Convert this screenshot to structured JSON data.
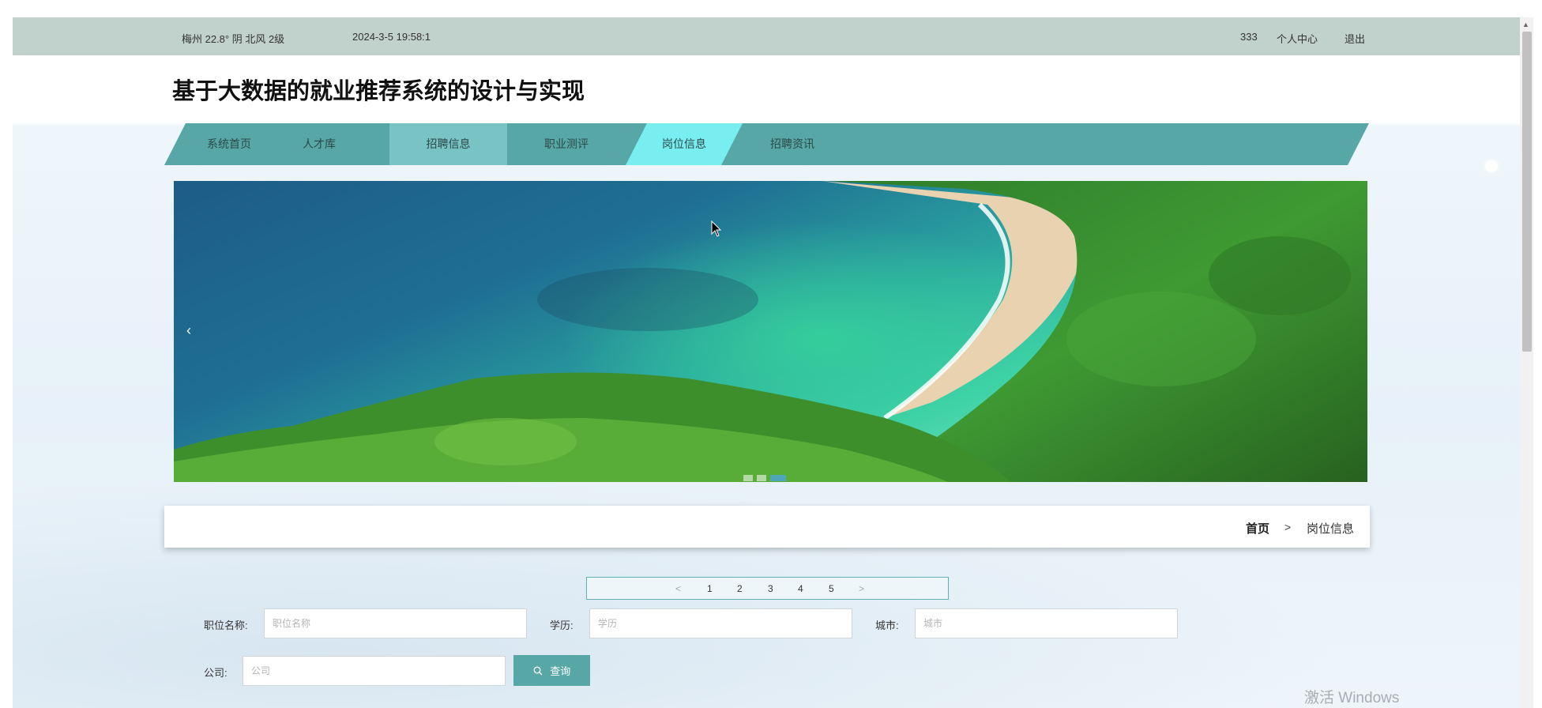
{
  "topbar": {
    "weather": "梅州 22.8° 阴 北风 2级",
    "datetime": "2024-3-5 19:58:1",
    "user": "333",
    "center": "个人中心",
    "logout": "退出"
  },
  "title": "基于大数据的就业推荐系统的设计与实现",
  "nav": [
    {
      "label": "系统首页"
    },
    {
      "label": "人才库"
    },
    {
      "label": "招聘信息"
    },
    {
      "label": "职业测评"
    },
    {
      "label": "岗位信息"
    },
    {
      "label": "招聘资讯"
    }
  ],
  "banner": {
    "prev_icon": "chevron-left-icon",
    "arrow": "‹",
    "slides_total": 3,
    "active_slide": 3
  },
  "breadcrumb": {
    "home": "首页",
    "sep": ">",
    "current": "岗位信息"
  },
  "pager": {
    "prev": "<",
    "pages": [
      "1",
      "2",
      "3",
      "4",
      "5"
    ],
    "next": ">"
  },
  "search": {
    "name_label": "职位名称:",
    "name_placeholder": "职位名称",
    "edu_label": "学历:",
    "edu_placeholder": "学历",
    "city_label": "城市:",
    "city_placeholder": "城市",
    "company_label": "公司:",
    "company_placeholder": "公司",
    "button": "查询",
    "button_icon": "search-icon"
  },
  "watermark": "激活 Windows",
  "colors": {
    "topbar": "#c1d1cb",
    "nav": "#56a7a5",
    "nav_active": "#78eef0",
    "nav_highlight": "#79c3c4",
    "button": "#56a7a5"
  }
}
